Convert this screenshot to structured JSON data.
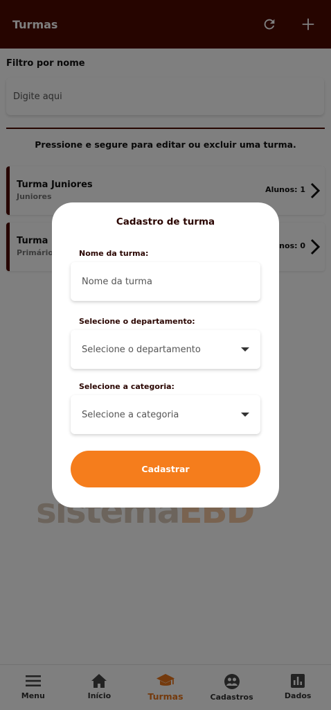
{
  "header": {
    "title": "Turmas",
    "refresh_icon": "refresh-icon",
    "add_icon": "plus-icon"
  },
  "filter": {
    "label": "Filtro por nome",
    "placeholder": "Digite aqui"
  },
  "hint": "Pressione e segure para editar ou excluir uma turma.",
  "classes": [
    {
      "name": "Turma Juniores",
      "department": "Juniores",
      "count": "Alunos: 1"
    },
    {
      "name": "Turma u",
      "department": "Primários",
      "count": "Alunos: 0"
    }
  ],
  "watermark": {
    "part1": "sistema",
    "part2": "EBD"
  },
  "modal": {
    "title": "Cadastro de turma",
    "name_label": "Nome da turma:",
    "name_placeholder": "Nome da turma",
    "dept_label": "Selecione o departamento:",
    "dept_value": "Selecione o departamento",
    "cat_label": "Selecione a categoria:",
    "cat_value": "Selecione a categoria",
    "submit_label": "Cadastrar"
  },
  "bottom_nav": [
    {
      "label": "Menu",
      "icon": "menu-icon"
    },
    {
      "label": "Início",
      "icon": "home-icon"
    },
    {
      "label": "Turmas",
      "icon": "graduation-cap-icon",
      "active": true
    },
    {
      "label": "Cadastros",
      "icon": "people-icon"
    },
    {
      "label": "Dados",
      "icon": "bar-chart-icon"
    }
  ],
  "colors": {
    "primary": "#4d0b00",
    "accent": "#f57d1c"
  }
}
